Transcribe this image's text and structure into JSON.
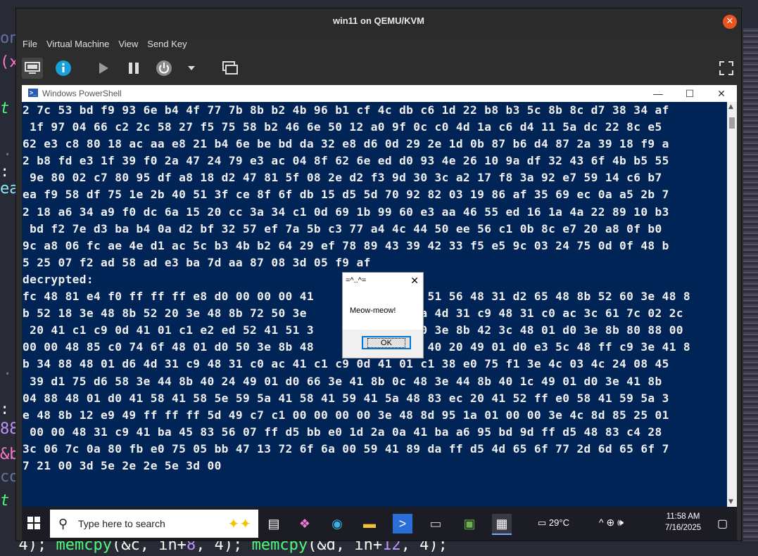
{
  "background_code": {
    "bottom_line": {
      "prefix": "  4); ",
      "fn1": "memcpy",
      "arg1": "(&c, in+",
      "num1": "8",
      "tail1": ", 4); ",
      "fn2": "memcpy",
      "arg2": "(&d, in+",
      "num2": "12",
      "tail2": ", 4);"
    },
    "left_fragments": [
      "on",
      "(x",
      "t",
      "·",
      ":",
      "ea",
      "·",
      ":",
      "88",
      "&b",
      "co",
      "t"
    ]
  },
  "vm_window": {
    "title": "win11 on QEMU/KVM",
    "menu": [
      "File",
      "Virtual Machine",
      "View",
      "Send Key"
    ],
    "toolbar_icons": [
      "monitor-icon",
      "info-icon",
      "play-icon",
      "pause-icon",
      "power-icon",
      "dropdown-arrow-icon",
      "screenshot-icon",
      "fullscreen-icon"
    ]
  },
  "powershell": {
    "title": "Windows PowerShell",
    "lines": [
      "2 7c 53 bd f9 93 6e b4 4f 77 7b 8b b2 4b 96 b1 cf 4c db c6 1d 22 b8 b3 5c 8b 8c d7 38 34 af",
      " 1f 97 04 66 c2 2c 58 27 f5 75 58 b2 46 6e 50 12 a0 9f 0c c0 4d 1a c6 d4 11 5a dc 22 8c e5",
      "62 e3 c8 80 18 ac aa e8 21 b4 6e be bd da 32 e8 d6 0d 29 2e 1d 0b 87 b6 d4 87 2a 39 18 f9 a",
      "2 b8 fd e3 1f 39 f0 2a 47 24 79 e3 ac 04 8f 62 6e ed d0 93 4e 26 10 9a df 32 43 6f 4b b5 55",
      " 9e 80 02 c7 80 95 df a8 18 d2 47 81 5f 08 2e d2 f3 9d 30 3c a2 17 f8 3a 92 e7 59 14 c6 b7",
      "ea f9 58 df 75 1e 2b 40 51 3f ce 8f 6f db 15 d5 5d 70 92 82 03 19 86 af 35 69 ec 0a a5 2b 7",
      "2 18 a6 34 a9 f0 dc 6a 15 20 cc 3a 34 c1 0d 69 1b 99 60 e3 aa 46 55 ed 16 1a 4a 22 89 10 b3",
      " bd f2 7e d3 ba b4 0a d2 bf 32 57 ef 7a 5b c3 77 a4 4c 44 50 ee 56 c1 0b 8c e7 20 a8 0f b0",
      "9c a8 06 fc ae 4e d1 ac 5c b3 4b b2 64 29 ef 78 89 43 39 42 33 f5 e5 9c 03 24 75 0d 0f 48 b",
      "5 25 07 f2 ad 58 ad e3 ba 7d aa 87 08 3d 05 f9 af",
      "decrypted:",
      "fc 48 81 e4 f0 ff ff ff e8 d0 00 00 00 41              2 51 56 48 31 d2 65 48 8b 52 60 3e 48 8",
      "b 52 18 3e 48 8b 52 20 3e 48 8b 72 50 3e               4a 4d 31 c9 48 31 c0 ac 3c 61 7c 02 2c",
      " 20 41 c1 c9 0d 41 01 c1 e2 ed 52 41 51 3              20 3e 8b 42 3c 48 01 d0 3e 8b 80 88 00",
      "00 00 48 85 c0 74 6f 48 01 d0 50 3e 8b 48              b 40 20 49 01 d0 e3 5c 48 ff c9 3e 41 8",
      "b 34 88 48 01 d6 4d 31 c9 48 31 c0 ac 41 c1 c9 0d 41 01 c1 38 e0 75 f1 3e 4c 03 4c 24 08 45",
      " 39 d1 75 d6 58 3e 44 8b 40 24 49 01 d0 66 3e 41 8b 0c 48 3e 44 8b 40 1c 49 01 d0 3e 41 8b",
      "04 88 48 01 d0 41 58 41 58 5e 59 5a 41 58 41 59 41 5a 48 83 ec 20 41 52 ff e0 58 41 59 5a 3",
      "e 48 8b 12 e9 49 ff ff ff 5d 49 c7 c1 00 00 00 00 3e 48 8d 95 1a 01 00 00 3e 4c 8d 85 25 01",
      " 00 00 48 31 c9 41 ba 45 83 56 07 ff d5 bb e0 1d 2a 0a 41 ba a6 95 bd 9d ff d5 48 83 c4 28",
      "3c 06 7c 0a 80 fb e0 75 05 bb 47 13 72 6f 6a 00 59 41 89 da ff d5 4d 65 6f 77 2d 6d 65 6f 7",
      "7 21 00 3d 5e 2e 2e 5e 3d 00"
    ]
  },
  "message_box": {
    "title": "=^..^=",
    "text": "Meow-meow!",
    "ok_label": "OK"
  },
  "taskbar": {
    "search_placeholder": "Type here to search",
    "weather": "29°C",
    "time": "11:58 AM",
    "date": "7/16/2025"
  }
}
